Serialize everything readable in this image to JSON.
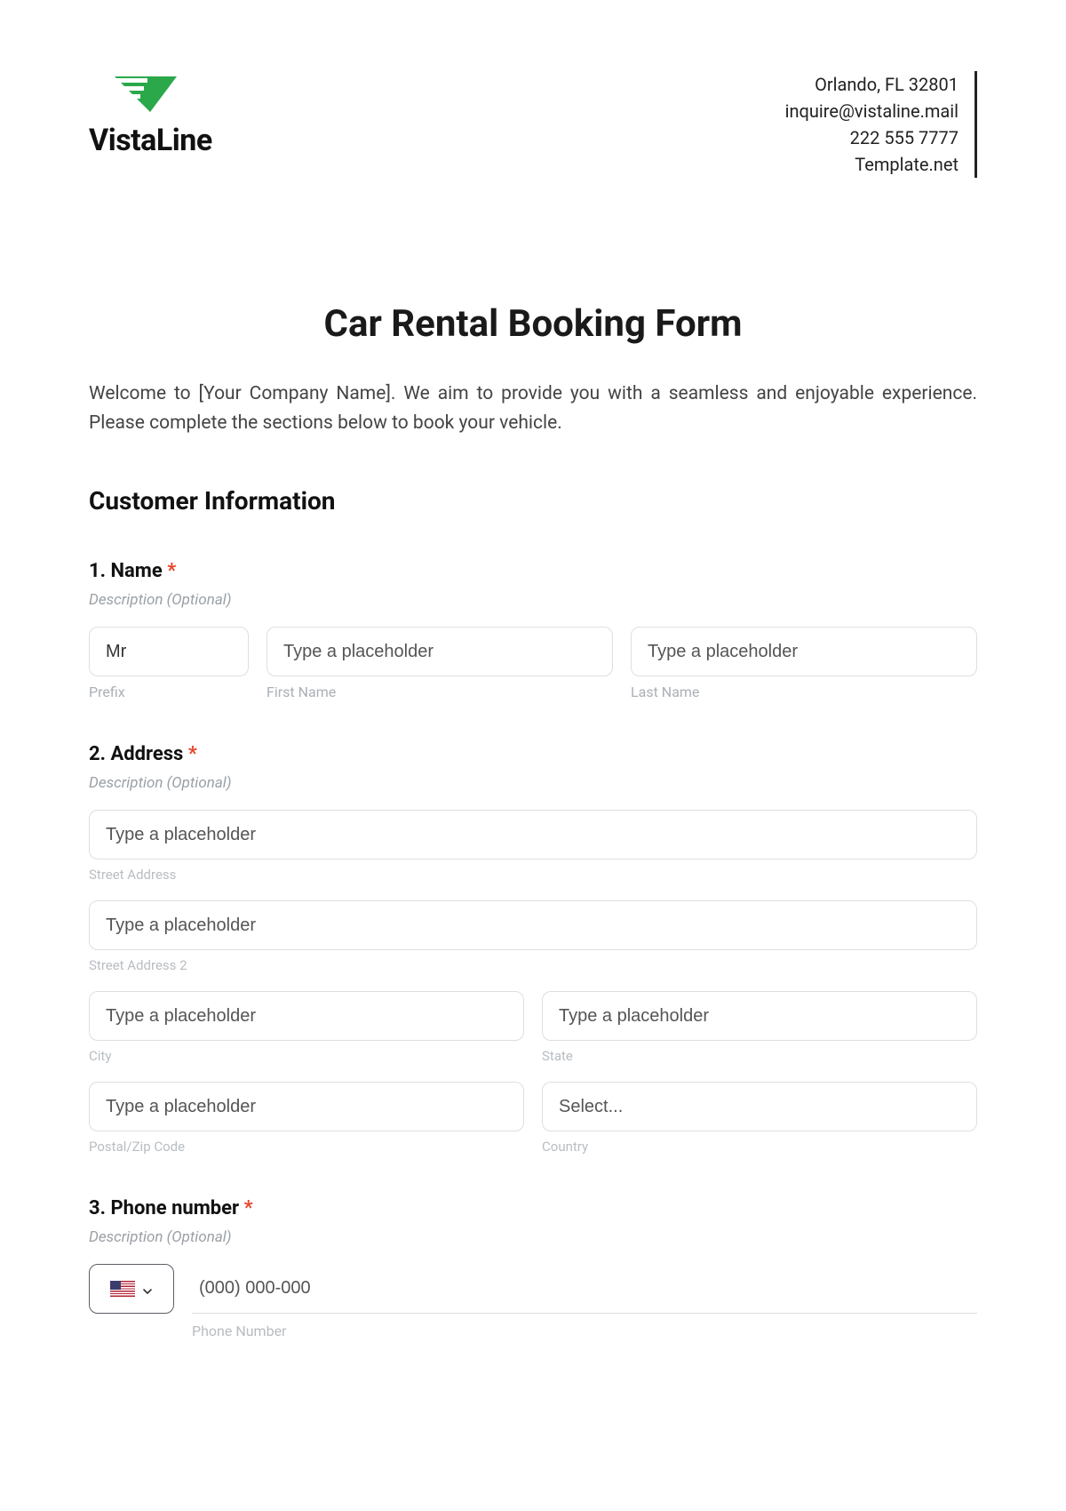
{
  "header": {
    "brand_name": "VistaLine",
    "contact": {
      "address": "Orlando, FL 32801",
      "email": "inquire@vistaline.mail",
      "phone": "222 555 7777",
      "site": "Template.net"
    }
  },
  "title": "Car Rental Booking Form",
  "intro": "Welcome to [Your Company Name]. We aim to provide you with a seamless and enjoyable experience. Please complete the sections below to book your vehicle.",
  "section_heading": "Customer Information",
  "questions": {
    "name": {
      "label": "1. Name",
      "required_marker": "*",
      "description": "Description (Optional)",
      "prefix": {
        "value": "Mr",
        "sublabel": "Prefix"
      },
      "first": {
        "placeholder": "Type a placeholder",
        "sublabel": "First Name"
      },
      "last": {
        "placeholder": "Type a placeholder",
        "sublabel": "Last Name"
      }
    },
    "address": {
      "label": "2. Address",
      "required_marker": "*",
      "description": "Description (Optional)",
      "street": {
        "placeholder": "Type a placeholder",
        "sublabel": "Street Address"
      },
      "street2": {
        "placeholder": "Type a placeholder",
        "sublabel": "Street Address 2"
      },
      "city": {
        "placeholder": "Type a placeholder",
        "sublabel": "City"
      },
      "state": {
        "placeholder": "Type a placeholder",
        "sublabel": "State"
      },
      "postal": {
        "placeholder": "Type a placeholder",
        "sublabel": "Postal/Zip Code"
      },
      "country": {
        "placeholder": "Select...",
        "sublabel": "Country"
      }
    },
    "phone": {
      "label": "3. Phone number",
      "required_marker": "*",
      "description": "Description (Optional)",
      "country_flag": "us",
      "number": {
        "placeholder": "(000) 000-000",
        "sublabel": "Phone Number"
      }
    }
  }
}
